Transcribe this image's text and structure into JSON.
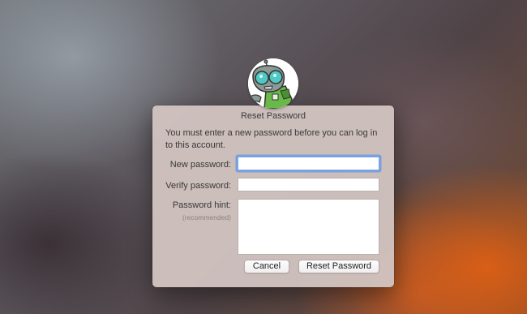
{
  "dialog": {
    "title": "Reset Password",
    "message": "You must enter a new password before you can log in to this account."
  },
  "form": {
    "new_password_label": "New password:",
    "new_password_value": "",
    "verify_password_label": "Verify password:",
    "verify_password_value": "",
    "hint_label": "Password hint:",
    "hint_sublabel": "(recommended)",
    "hint_value": ""
  },
  "buttons": {
    "cancel": "Cancel",
    "reset": "Reset Password"
  },
  "avatar": {
    "icon": "robot-avatar-icon",
    "colors": {
      "body": "#8a9a94",
      "eyes": "#4fc9c6",
      "accent": "#6ab84a"
    }
  },
  "colors": {
    "focus_ring": "#6096e6",
    "dialog_bg": "#d0c3c0"
  }
}
